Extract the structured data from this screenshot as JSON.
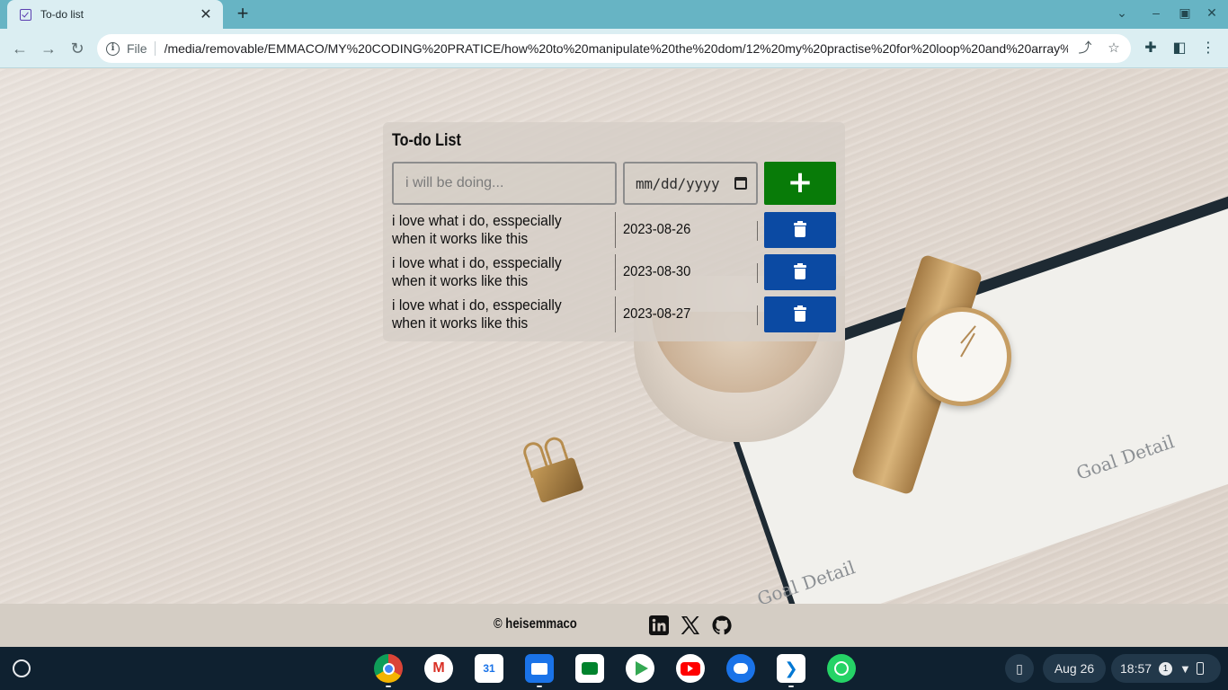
{
  "browser": {
    "tab_title": "To-do list",
    "tab_close": "✕",
    "new_tab": "+",
    "omnibox_chip": "File",
    "url": "/media/removable/EMMACO/MY%20CODING%20PRATICE/how%20to%20manipulate%20the%20dom/12%20my%20practise%20for%20loop%20and%20array%..."
  },
  "todo": {
    "title": "To-do List",
    "input_placeholder": "i will be doing...",
    "date_placeholder": "mm/dd/yyyy",
    "add_label": "+",
    "items": [
      {
        "text": "i love what i do, esspecially when it works like this",
        "date": "2023-08-26"
      },
      {
        "text": "i love what i do, esspecially when it works like this",
        "date": "2023-08-30"
      },
      {
        "text": "i love what i do, esspecially when it works like this",
        "date": "2023-08-27"
      }
    ]
  },
  "footer": {
    "copyright": "© heisemmaco",
    "social_icons": [
      "linkedin-icon",
      "x-icon",
      "github-icon"
    ]
  },
  "background": {
    "notebook_text_1": "Goal Detail",
    "notebook_text_2": "Goal Detail"
  },
  "taskbar": {
    "apps": [
      "chrome",
      "gmail",
      "calendar",
      "files",
      "meet",
      "play-store",
      "youtube",
      "messages",
      "vscode",
      "whatsapp"
    ],
    "calendar_day": "31",
    "date": "Aug 26",
    "time": "18:57",
    "notification_count": "1"
  },
  "colors": {
    "add_button": "#087b08",
    "delete_button": "#0b4aa3",
    "tabstrip": "#67b4c4",
    "taskbar": "#0f2130"
  }
}
